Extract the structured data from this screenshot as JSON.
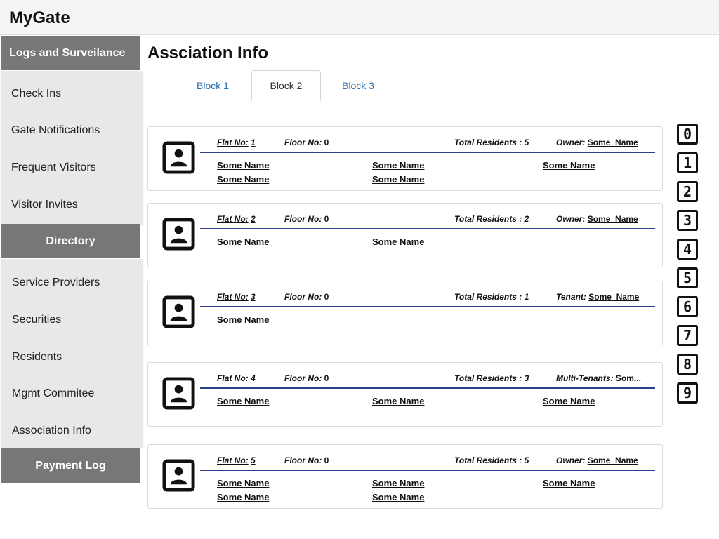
{
  "app": {
    "title": "MyGate"
  },
  "sidebar": {
    "sections": [
      {
        "title": "Logs and Surveilance",
        "items": [
          "Check Ins",
          "Gate Notifications",
          "Frequent Visitors",
          "Visitor Invites"
        ]
      },
      {
        "title": "Directory",
        "items": [
          "Service Providers",
          "Securities",
          "Residents",
          "Mgmt Commitee",
          "Association Info"
        ]
      },
      {
        "title": "Payment Log",
        "items": []
      }
    ]
  },
  "page": {
    "title": "Assciation Info"
  },
  "tabs": [
    {
      "label": "Block 1",
      "active": false
    },
    {
      "label": "Block 2",
      "active": true
    },
    {
      "label": "Block 3",
      "active": false
    }
  ],
  "labels": {
    "flat": "Flat No:",
    "floor": "Floor No:"
  },
  "flats": [
    {
      "flat_no": "1",
      "floor_no": "0",
      "total_residents": "Total Residents : 5",
      "owner_label": "Owner:",
      "owner_name": "Some_Name",
      "residents": [
        "Some Name",
        "Some Name",
        "Some Name",
        "Some Name",
        "Some Name"
      ]
    },
    {
      "flat_no": "2",
      "floor_no": "0",
      "total_residents": "Total Residents : 2",
      "owner_label": "Owner:",
      "owner_name": "Some_Name",
      "residents": [
        "Some Name",
        "Some Name"
      ]
    },
    {
      "flat_no": "3",
      "floor_no": "0",
      "total_residents": "Total Residents : 1",
      "owner_label": "Tenant:",
      "owner_name": "Some_Name",
      "residents": [
        "Some Name"
      ]
    },
    {
      "flat_no": "4",
      "floor_no": "0",
      "total_residents": "Total Residents : 3",
      "owner_label": "Multi-Tenants:",
      "owner_name": "Som...",
      "residents": [
        "Some Name",
        "Some Name",
        "Some Name"
      ]
    },
    {
      "flat_no": "5",
      "floor_no": "0",
      "total_residents": "Total Residents : 5",
      "owner_label": "Owner:",
      "owner_name": "Some_Name",
      "residents": [
        "Some Name",
        "Some Name",
        "Some Name",
        "Some Name",
        "Some Name"
      ]
    }
  ],
  "floor_index": [
    "0",
    "1",
    "2",
    "3",
    "4",
    "5",
    "6",
    "7",
    "8",
    "9"
  ],
  "colors": {
    "sidebar_header": "#777777",
    "sidebar_body": "#e8e8e8",
    "divider": "#2d3f8a",
    "tab_link": "#2a6fb0"
  },
  "icons": {
    "avatar": "contact-card-icon"
  }
}
